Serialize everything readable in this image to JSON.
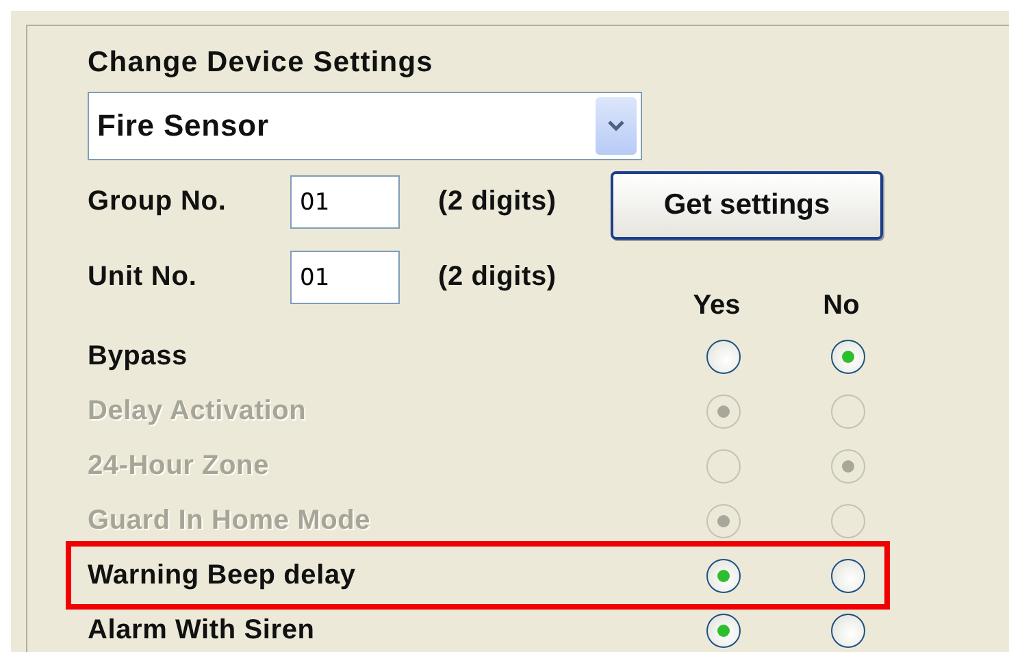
{
  "title": "Change Device Settings",
  "device_select": {
    "value": "Fire Sensor"
  },
  "fields": [
    {
      "label": "Group No.",
      "value": "01",
      "hint": "(2 digits)"
    },
    {
      "label": "Unit No.",
      "value": "01",
      "hint": "(2 digits)"
    }
  ],
  "get_settings_button": "Get settings",
  "columns": [
    "Yes",
    "No"
  ],
  "options": [
    {
      "label": "Bypass",
      "disabled": false,
      "highlighted": false,
      "choices": [
        {
          "selected": false
        },
        {
          "selected": true
        }
      ]
    },
    {
      "label": "Delay Activation",
      "disabled": true,
      "highlighted": false,
      "choices": [
        {
          "selected": true
        },
        {
          "selected": false
        }
      ]
    },
    {
      "label": "24-Hour Zone",
      "disabled": true,
      "highlighted": false,
      "choices": [
        {
          "selected": false
        },
        {
          "selected": true
        }
      ]
    },
    {
      "label": "Guard In Home Mode",
      "disabled": true,
      "highlighted": false,
      "choices": [
        {
          "selected": true
        },
        {
          "selected": false
        }
      ]
    },
    {
      "label": "Warning Beep delay",
      "disabled": false,
      "highlighted": true,
      "choices": [
        {
          "selected": true
        },
        {
          "selected": false
        }
      ]
    },
    {
      "label": "Alarm With Siren",
      "disabled": false,
      "highlighted": false,
      "choices": [
        {
          "selected": true
        },
        {
          "selected": false
        }
      ]
    }
  ]
}
